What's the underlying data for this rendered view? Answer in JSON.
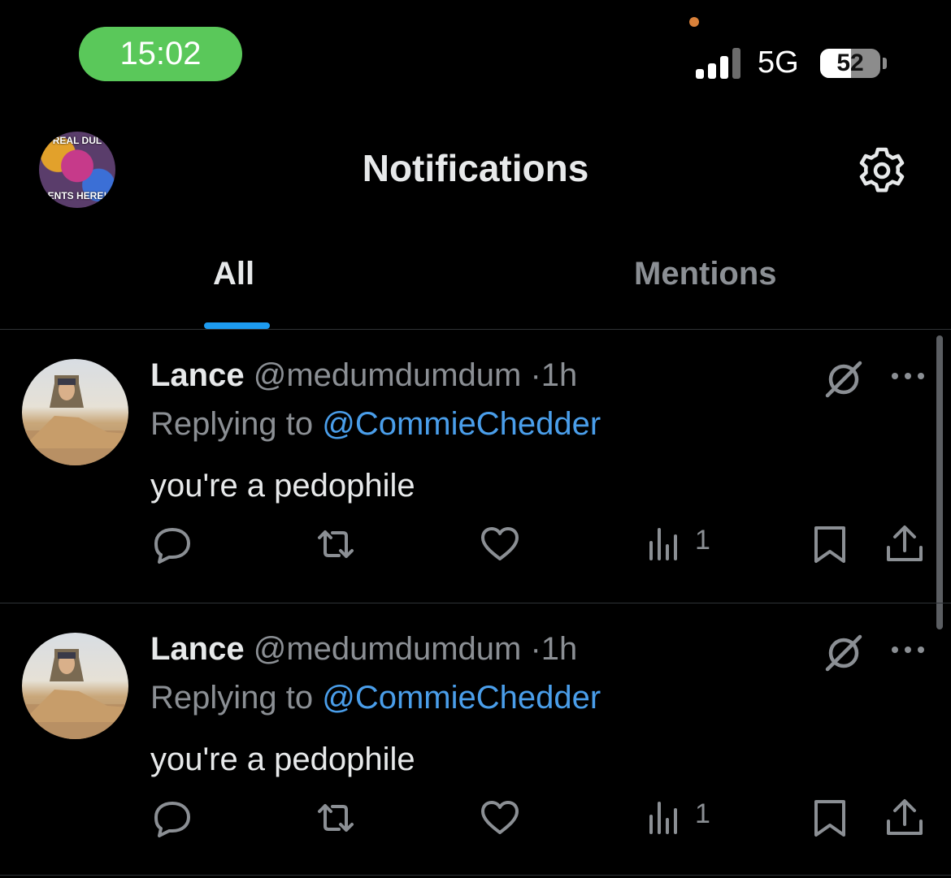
{
  "status_bar": {
    "time": "15:02",
    "network": "5G",
    "battery": 52
  },
  "header": {
    "avatar_text_top": "REAL DUL",
    "avatar_text_bottom": "ENTS HERE!",
    "title": "Notifications"
  },
  "tabs": [
    {
      "label": "All",
      "active": true
    },
    {
      "label": "Mentions",
      "active": false
    }
  ],
  "notifications": [
    {
      "name": "Lance",
      "handle": "@medumdumdum",
      "separator": "·",
      "time": "1h",
      "replying_prefix": "Replying to",
      "replying_to": "@CommieChedder",
      "text": "you're a pedophile",
      "views": "1"
    },
    {
      "name": "Lance",
      "handle": "@medumdumdum",
      "separator": "·",
      "time": "1h",
      "replying_prefix": "Replying to",
      "replying_to": "@CommieChedder",
      "text": "you're a pedophile",
      "views": "1"
    }
  ],
  "colors": {
    "background": "#000000",
    "accent": "#1d9bf0",
    "mention": "#4a9eea",
    "secondary_text": "#8b8f94",
    "time_pill": "#5ac85a"
  },
  "icons": [
    "signal-icon",
    "battery-icon",
    "settings-gear-icon",
    "grok-icon",
    "more-icon",
    "reply-icon",
    "repost-icon",
    "like-icon",
    "views-icon",
    "bookmark-icon",
    "share-icon"
  ]
}
